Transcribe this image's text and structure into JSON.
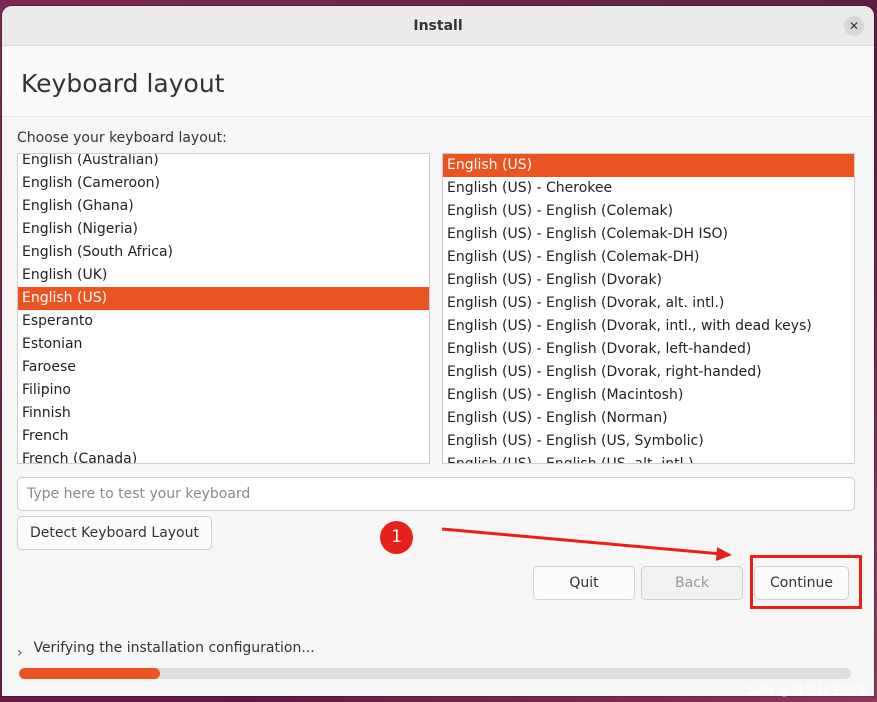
{
  "window": {
    "title": "Install",
    "close_glyph": "✕"
  },
  "page": {
    "title": "Keyboard layout",
    "prompt": "Choose your keyboard layout:"
  },
  "layouts": [
    "English (Australian)",
    "English (Cameroon)",
    "English (Ghana)",
    "English (Nigeria)",
    "English (South Africa)",
    "English (UK)",
    "English (US)",
    "Esperanto",
    "Estonian",
    "Faroese",
    "Filipino",
    "Finnish",
    "French",
    "French (Canada)"
  ],
  "layouts_selected_index": 6,
  "variants": [
    "English (US)",
    "English (US) - Cherokee",
    "English (US) - English (Colemak)",
    "English (US) - English (Colemak-DH ISO)",
    "English (US) - English (Colemak-DH)",
    "English (US) - English (Dvorak)",
    "English (US) - English (Dvorak, alt. intl.)",
    "English (US) - English (Dvorak, intl., with dead keys)",
    "English (US) - English (Dvorak, left-handed)",
    "English (US) - English (Dvorak, right-handed)",
    "English (US) - English (Macintosh)",
    "English (US) - English (Norman)",
    "English (US) - English (US, Symbolic)",
    "English (US) - English (US, alt. intl.)"
  ],
  "variants_selected_index": 0,
  "test_input": {
    "placeholder": "Type here to test your keyboard",
    "value": ""
  },
  "buttons": {
    "detect": "Detect Keyboard Layout",
    "quit": "Quit",
    "back": "Back",
    "continue": "Continue"
  },
  "annotation": {
    "badge": "1",
    "color": "#e8201a"
  },
  "status": {
    "text": "Verifying the installation configuration...",
    "progress": 0.17
  },
  "accent_color": "#e95420",
  "watermark": "CSDN @跳河轻生的鱼"
}
